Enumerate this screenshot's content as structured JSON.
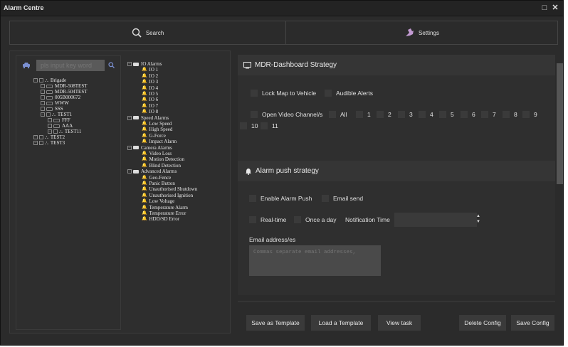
{
  "window": {
    "title": "Alarm Centre",
    "maximize_glyph": "□",
    "close_glyph": "✕"
  },
  "topbar": {
    "search_label": "Search",
    "settings_label": "Settings"
  },
  "vehicle_search": {
    "placeholder": "pls input key word"
  },
  "vehicle_tree": [
    {
      "label": "Brigade",
      "kind": "group",
      "level": 0
    },
    {
      "label": "MDR-508TEST",
      "kind": "device",
      "level": 1
    },
    {
      "label": "MDR-504TEST",
      "kind": "device",
      "level": 1
    },
    {
      "label": "005B000672",
      "kind": "device",
      "level": 1
    },
    {
      "label": "WWW",
      "kind": "device",
      "level": 1
    },
    {
      "label": "SSS",
      "kind": "device",
      "level": 1
    },
    {
      "label": "TEST1",
      "kind": "group",
      "level": 1
    },
    {
      "label": "FFF",
      "kind": "device",
      "level": 2
    },
    {
      "label": "AAA",
      "kind": "device",
      "level": 2
    },
    {
      "label": "TEST11",
      "kind": "group",
      "level": 2
    },
    {
      "label": "TEST2",
      "kind": "group",
      "level": 0
    },
    {
      "label": "TEST3",
      "kind": "group",
      "level": 0
    }
  ],
  "alarm_tree": [
    {
      "label": "IO Alarms",
      "kind": "category"
    },
    {
      "label": "IO 1",
      "kind": "alarm"
    },
    {
      "label": "IO 2",
      "kind": "alarm"
    },
    {
      "label": "IO 3",
      "kind": "alarm"
    },
    {
      "label": "IO 4",
      "kind": "alarm"
    },
    {
      "label": "IO 5",
      "kind": "alarm"
    },
    {
      "label": "IO 6",
      "kind": "alarm"
    },
    {
      "label": "IO 7",
      "kind": "alarm"
    },
    {
      "label": "IO 8",
      "kind": "alarm"
    },
    {
      "label": "Speed Alarms",
      "kind": "category"
    },
    {
      "label": "Low Speed",
      "kind": "alarm"
    },
    {
      "label": "High Speed",
      "kind": "alarm"
    },
    {
      "label": "G-Force",
      "kind": "alarm"
    },
    {
      "label": "Impact Alarm",
      "kind": "alarm"
    },
    {
      "label": "Camera Alarms",
      "kind": "category"
    },
    {
      "label": "Video Loss",
      "kind": "alarm"
    },
    {
      "label": "Motion Detection",
      "kind": "alarm"
    },
    {
      "label": "Blind Detection",
      "kind": "alarm"
    },
    {
      "label": "Advanced Alarms",
      "kind": "category"
    },
    {
      "label": "Geo-Fence",
      "kind": "alarm"
    },
    {
      "label": "Panic Button",
      "kind": "alarm"
    },
    {
      "label": "Unauthorised Shutdown",
      "kind": "alarm"
    },
    {
      "label": "Unauthorised Ignition",
      "kind": "alarm"
    },
    {
      "label": "Low Voltage",
      "kind": "alarm"
    },
    {
      "label": "Temperature Alarm",
      "kind": "alarm"
    },
    {
      "label": "Temperature Error",
      "kind": "alarm"
    },
    {
      "label": "HDD/SD Error",
      "kind": "alarm"
    }
  ],
  "dashboard_strategy": {
    "title": "MDR-Dashboard Strategy",
    "lock_map": "Lock Map to Vehicle",
    "audible_alerts": "Audible Alerts",
    "open_video": "Open Video Channel/s",
    "channels": [
      "All",
      "1",
      "2",
      "3",
      "4",
      "5",
      "6",
      "7",
      "8",
      "9",
      "10",
      "11"
    ]
  },
  "push_strategy": {
    "title": "Alarm push strategy",
    "enable_push": "Enable Alarm Push",
    "email_send": "Email send",
    "realtime": "Real-time",
    "once_a_day": "Once a day",
    "notification_time": "Notification Time",
    "email_label": "Email address/es",
    "email_placeholder": "Commas separate email addresses,"
  },
  "buttons": {
    "save_template": "Save as Template",
    "load_template": "Load a Template",
    "view_task": "View task",
    "delete_config": "Delete Config",
    "save_config": "Save Config"
  }
}
